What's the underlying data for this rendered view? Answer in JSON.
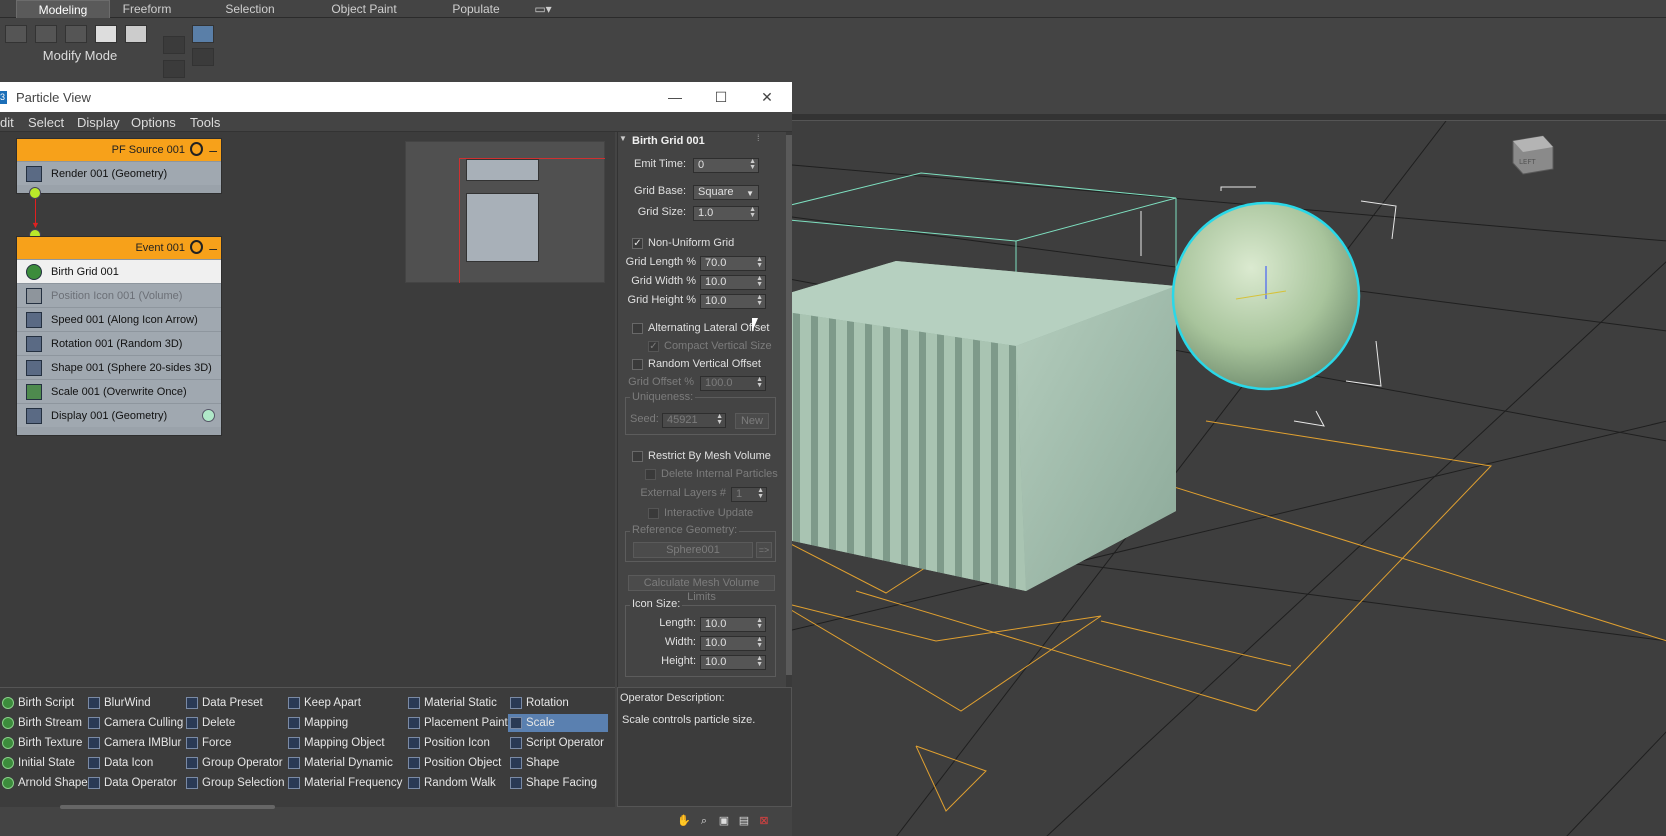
{
  "ribbon": {
    "tabs": [
      "Modeling",
      "Freeform",
      "Selection",
      "Object Paint",
      "Populate"
    ],
    "mode_label": "Modify Mode"
  },
  "window": {
    "title": "Particle View",
    "icon_text": "3",
    "controls": {
      "minimize": "—",
      "maximize": "☐",
      "close": "✕"
    }
  },
  "menubar": [
    "dit",
    "Select",
    "Display",
    "Options",
    "Tools"
  ],
  "nodes": {
    "source": {
      "title": "PF Source 001",
      "ops": [
        "Render 001 (Geometry)"
      ]
    },
    "event": {
      "title": "Event 001",
      "ops": [
        "Birth Grid 001",
        "Position Icon 001 (Volume)",
        "Speed 001 (Along Icon Arrow)",
        "Rotation 001 (Random 3D)",
        "Shape 001 (Sphere 20-sides 3D)",
        "Scale 001 (Overwrite Once)",
        "Display 001 (Geometry)"
      ]
    }
  },
  "params": {
    "rollout_title": "Birth Grid 001",
    "emit_time_label": "Emit Time:",
    "emit_time": "0",
    "grid_base_label": "Grid Base:",
    "grid_base": "Square",
    "grid_size_label": "Grid Size:",
    "grid_size": "1.0",
    "non_uniform_label": "Non-Uniform Grid",
    "grid_length_label": "Grid Length %",
    "grid_length": "70.0",
    "grid_width_label": "Grid Width %",
    "grid_width": "10.0",
    "grid_height_label": "Grid Height %",
    "grid_height": "10.0",
    "alt_lateral_label": "Alternating Lateral Offset",
    "compact_vertical_label": "Compact Vertical Size",
    "random_vertical_label": "Random Vertical Offset",
    "grid_offset_label": "Grid Offset %",
    "grid_offset": "100.0",
    "uniqueness_label": "Uniqueness:",
    "seed_label": "Seed:",
    "seed": "45921",
    "new_label": "New",
    "restrict_label": "Restrict By Mesh Volume",
    "delete_internal_label": "Delete Internal Particles",
    "external_layers_label": "External Layers #",
    "external_layers": "1",
    "interactive_update_label": "Interactive Update",
    "reference_geometry_label": "Reference Geometry:",
    "reference_geometry": "Sphere001",
    "ref_pick": "=>",
    "calc_limits_label": "Calculate Mesh Volume Limits",
    "icon_size_label": "Icon Size:",
    "length_label": "Length:",
    "length": "10.0",
    "width_label": "Width:",
    "width": "10.0",
    "height_label": "Height:",
    "height": "10.0"
  },
  "depot": {
    "columns": [
      [
        "Birth Script",
        "Birth Stream",
        "Birth Texture",
        "Initial State",
        "Arnold Shape"
      ],
      [
        "BlurWind",
        "Camera Culling",
        "Camera IMBlur",
        "Data Icon",
        "Data Operator"
      ],
      [
        "Data Preset",
        "Delete",
        "Force",
        "Group Operator",
        "Group Selection"
      ],
      [
        "Keep Apart",
        "Mapping",
        "Mapping Object",
        "Material Dynamic",
        "Material Frequency"
      ],
      [
        "Material Static",
        "Placement Paint",
        "Position Icon",
        "Position Object",
        "Random Walk"
      ],
      [
        "Rotation",
        "Scale",
        "Script Operator",
        "Shape",
        "Shape Facing"
      ]
    ],
    "selected": "Scale"
  },
  "description": {
    "header": "Operator Description:",
    "text": "Scale controls particle size."
  },
  "colors": {
    "event_header": "#f7a11a",
    "selection": "#5a80b0",
    "particle_green": "#9ec2ad",
    "sphere_outline": "#2ad8e8",
    "grid_orange": "#e0a030"
  },
  "viewport": {
    "cube_label": "LEFT"
  }
}
